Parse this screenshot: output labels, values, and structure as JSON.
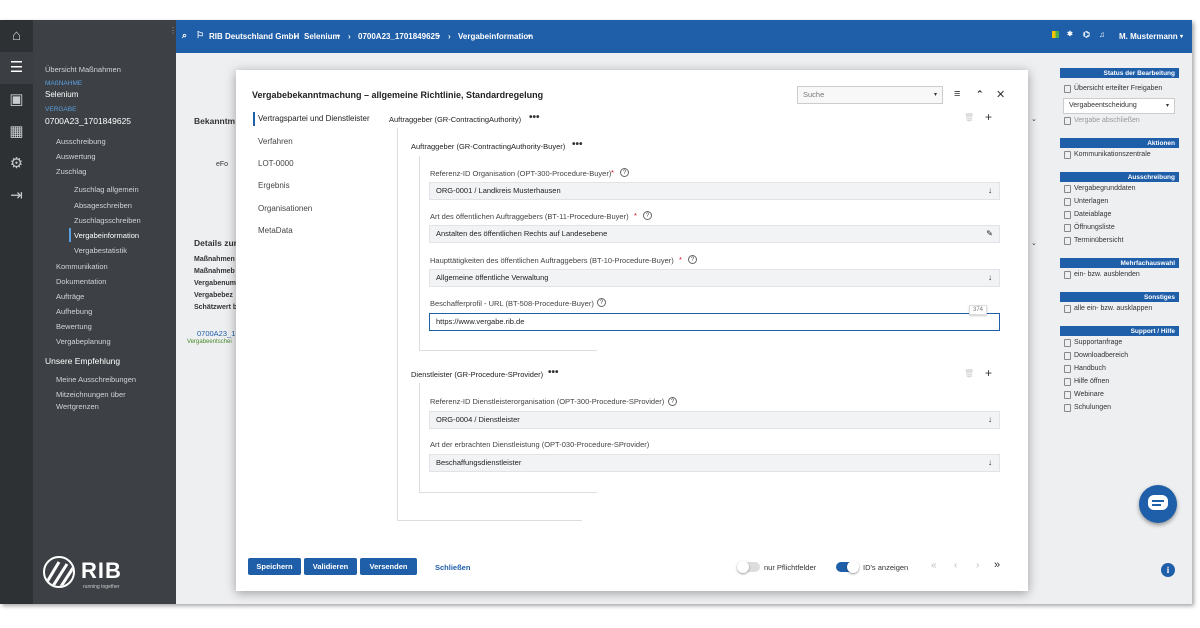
{
  "topbar": {
    "crumbs": [
      "RIB Deutschland GmbH",
      "Selenium",
      "0700A23_1701849625",
      "Vergabeinformation"
    ],
    "user": "M. Mustermann"
  },
  "nav": {
    "overview": "Übersicht Maßnahmen",
    "massnahme_label": "MAßNAHME",
    "massnahme_value": "Selenium",
    "vergabe_label": "VERGABE",
    "vergabe_value": "0700A23_1701849625",
    "items": [
      "Ausschreibung",
      "Auswertung",
      "Zuschlag"
    ],
    "zuschlag_sub": [
      "Zuschlag allgemein",
      "Absageschreiben",
      "Zuschlagsschreiben",
      "Vergabeinformation",
      "Vergabestatistik"
    ],
    "items2": [
      "Kommunikation",
      "Dokumentation",
      "Aufträge",
      "Aufhebung",
      "Bewertung",
      "Vergabeplanung"
    ],
    "empfehlung": "Unsere Empfehlung",
    "empf_items": [
      "Meine Ausschreibungen",
      "Mitzeichnungen über",
      "Wertgrenzen"
    ],
    "logo_text": "RIB",
    "logo_tagline": "running together"
  },
  "background": {
    "bekanntm": "Bekanntm",
    "efo": "eFo",
    "details": "Details zur",
    "details_rows": [
      "Maßnahmen",
      "Maßnahmeb",
      "Vergabenum",
      "Vergabebez",
      "Schätzwert b"
    ],
    "link_id": "0700A23_1",
    "link_sub": "Vergabeentschei"
  },
  "right_panel": {
    "status_header": "Status der Bearbeitung",
    "status_link": "Übersicht erteilter Freigaben",
    "select_value": "Vergabeentscheidung",
    "vergabe_abschliessen": "Vergabe abschließen",
    "aktionen": "Aktionen",
    "aktionen_items": [
      "Kommunikationszentrale"
    ],
    "ausschreibung": "Ausschreibung",
    "ausschreibung_items": [
      "Vergabegrunddaten",
      "Unterlagen",
      "Dateiablage",
      "Öffnungsliste",
      "Terminübersicht"
    ],
    "mehrfach": "Mehrfachauswahl",
    "mehrfach_items": [
      "ein- bzw. ausblenden"
    ],
    "sonstiges": "Sonstiges",
    "sonstiges_items": [
      "alle ein- bzw. ausklappen"
    ],
    "support": "Support / Hilfe",
    "support_items": [
      "Supportanfrage",
      "Downloadbereich",
      "Handbuch",
      "Hilfe öffnen",
      "Webinare",
      "Schulungen"
    ]
  },
  "modal": {
    "title": "Vergabebekanntmachung – allgemeine Richtlinie, Standardregelung",
    "search_placeholder": "Suche",
    "tabs": [
      "Vertragspartei und Dienstleister",
      "Verfahren",
      "LOT-0000",
      "Ergebnis",
      "Organisationen",
      "MetaData"
    ],
    "group1_title": "Auftraggeber (GR-ContractingAuthority)",
    "subgroup1_title": "Auftraggeber (GR-ContractingAuthority-Buyer)",
    "fields1": [
      {
        "label": "Referenz-ID Organisation (OPT-300-Procedure-Buyer)",
        "required": "*",
        "value": "ORG-0001 / Landkreis Musterhausen"
      },
      {
        "label": "Art des öffentlichen Auftraggebers (BT-11-Procedure-Buyer)",
        "required": "*",
        "value": "Anstalten des öffentlichen Rechts auf Landesebene"
      },
      {
        "label": "Haupttätigkeiten des öffentlichen Auftraggebers (BT-10-Procedure-Buyer)",
        "required": "*",
        "value": "Allgemeine öffentliche Verwaltung"
      },
      {
        "label": "Beschafferprofil - URL (BT-508-Procedure-Buyer)",
        "required": "",
        "value": "https://www.vergabe.rib.de"
      }
    ],
    "char_counter": "374",
    "group2_title": "Dienstleister (GR-Procedure-SProvider)",
    "fields2": [
      {
        "label": "Referenz-ID Dienstleisterorganisation (OPT-300-Procedure-SProvider)",
        "value": "ORG-0004 / Dienstleister"
      },
      {
        "label": "Art der erbrachten Dienstleistung (OPT-030-Procedure-SProvider)",
        "value": "Beschaffungsdienstleister"
      }
    ],
    "footer": {
      "save": "Speichern",
      "validate": "Validieren",
      "send": "Versenden",
      "close": "Schließen",
      "pflicht": "nur Pflichtfelder",
      "ids": "ID's anzeigen"
    }
  },
  "colors": {
    "primary": "#1f5ea8",
    "sidebar": "#3d4145",
    "rail": "#2e3134",
    "required": "#d0021b"
  }
}
